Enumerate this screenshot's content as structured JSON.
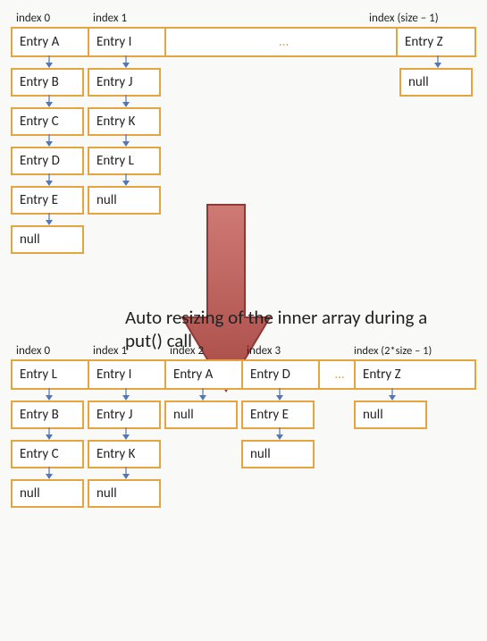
{
  "top": {
    "indexLabels": [
      "index 0",
      "index 1",
      "index (size – 1)"
    ],
    "ellipsis": "…",
    "arrayRow": [
      "Entry A",
      "Entry I",
      "Entry Z"
    ],
    "chains": [
      [
        "Entry B",
        "Entry C",
        "Entry D",
        "Entry E",
        "null"
      ],
      [
        "Entry J",
        "Entry K",
        "Entry L",
        "null"
      ],
      [],
      [
        "null"
      ]
    ]
  },
  "caption": "Auto resizing of the inner array during a put() call",
  "bottom": {
    "indexLabels": [
      "index 0",
      "index 1",
      "index 2",
      "index 3",
      "index (2*size – 1)"
    ],
    "ellipsis": "…",
    "arrayRow": [
      "Entry L",
      "Entry I",
      "Entry A",
      "Entry D",
      "Entry Z"
    ],
    "chains": [
      [
        "Entry B",
        "Entry C",
        "null"
      ],
      [
        "Entry J",
        "Entry K",
        "null"
      ],
      [
        "null"
      ],
      [
        "Entry E",
        "null"
      ],
      [],
      [
        "null"
      ]
    ]
  },
  "colors": {
    "border": "#e6a441",
    "arrowFill": "#b85450",
    "arrowStroke": "#8b3a38",
    "linkArrow": "#5577aa"
  }
}
